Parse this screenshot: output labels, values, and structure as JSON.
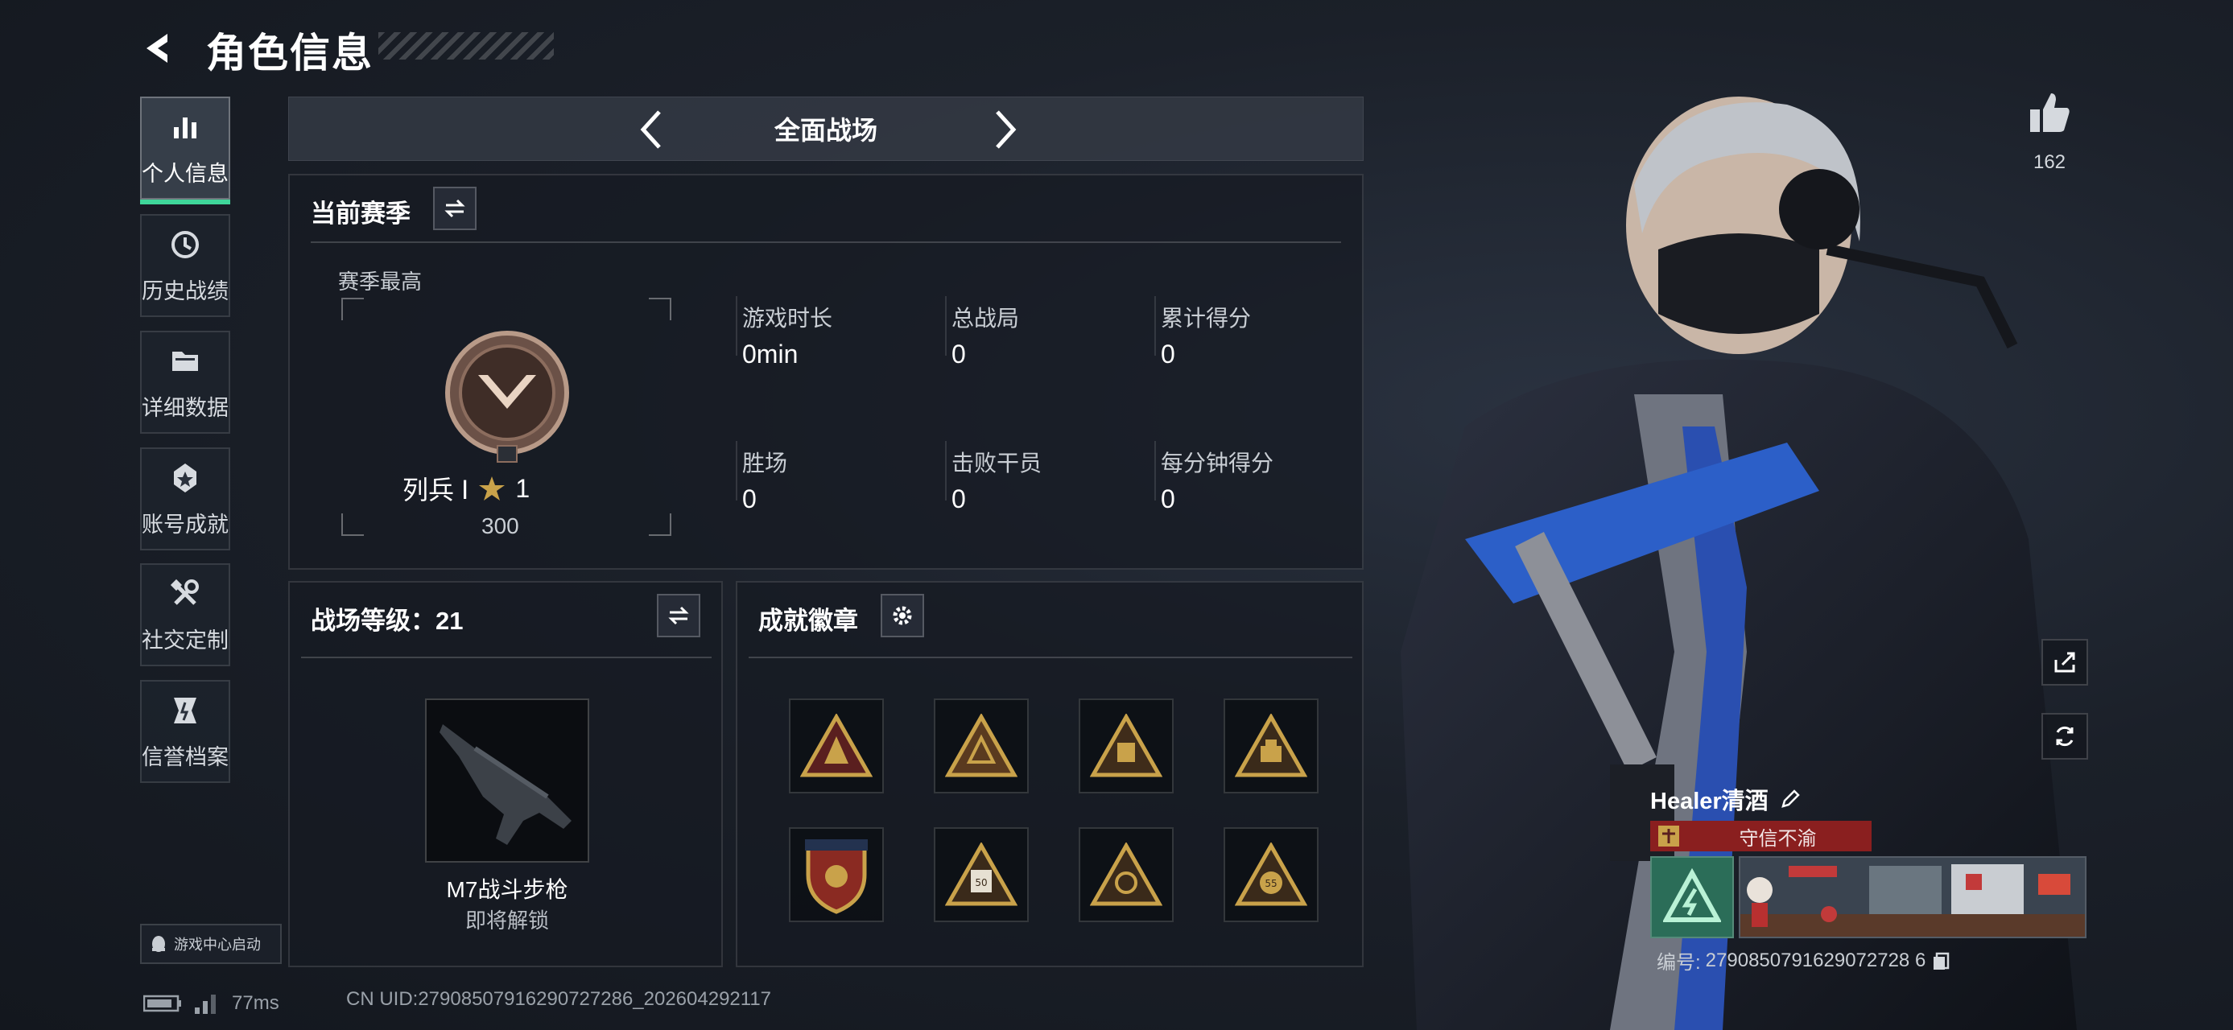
{
  "header": {
    "title": "角色信息"
  },
  "sidebar": {
    "items": [
      {
        "label": "个人信息",
        "icon": "bar-chart-icon",
        "active": true
      },
      {
        "label": "历史战绩",
        "icon": "history-clock-icon"
      },
      {
        "label": "详细数据",
        "icon": "folder-icon"
      },
      {
        "label": "账号成就",
        "icon": "achievement-medal-icon"
      },
      {
        "label": "社交定制",
        "icon": "tools-icon"
      },
      {
        "label": "信誉档案",
        "icon": "shield-emblem-icon"
      }
    ],
    "launch_label": "游戏中心启动"
  },
  "mode": {
    "label": "全面战场"
  },
  "season": {
    "title": "当前赛季",
    "best_label": "赛季最高",
    "rank_name": "列兵 Ⅰ",
    "stars": "1",
    "score": "300",
    "rank_numeral": "Ⅰ",
    "stats": [
      {
        "label": "游戏时长",
        "value": "0min"
      },
      {
        "label": "总战局",
        "value": "0"
      },
      {
        "label": "累计得分",
        "value": "0"
      },
      {
        "label": "胜场",
        "value": "0"
      },
      {
        "label": "击败干员",
        "value": "0"
      },
      {
        "label": "每分钟得分",
        "value": "0"
      }
    ]
  },
  "level": {
    "title": "战场等级：21",
    "weapon_name": "M7战斗步枪",
    "weapon_status": "即将解锁"
  },
  "badges": {
    "title": "成就徽章",
    "items": [
      "gold-triangle-badge",
      "gold-triangle-badge",
      "gold-triangle-badge",
      "gold-triangle-badge",
      "shield-crest-badge",
      "gold-triangle-badge",
      "gold-triangle-badge",
      "gold-triangle-badge"
    ],
    "numbers": [
      "50",
      "55"
    ]
  },
  "profile": {
    "likes": "162",
    "name": "Healer清酒",
    "motto": "守信不渝",
    "id_label": "编号:",
    "id": "2790850791629072728 6"
  },
  "status": {
    "ping": "77ms",
    "uid": "CN UID:279085079162907272​86_202604292117"
  },
  "colors": {
    "accent": "#3fd69a",
    "motto_bg": "#8a1f1f",
    "gold": "#c9a24a"
  }
}
